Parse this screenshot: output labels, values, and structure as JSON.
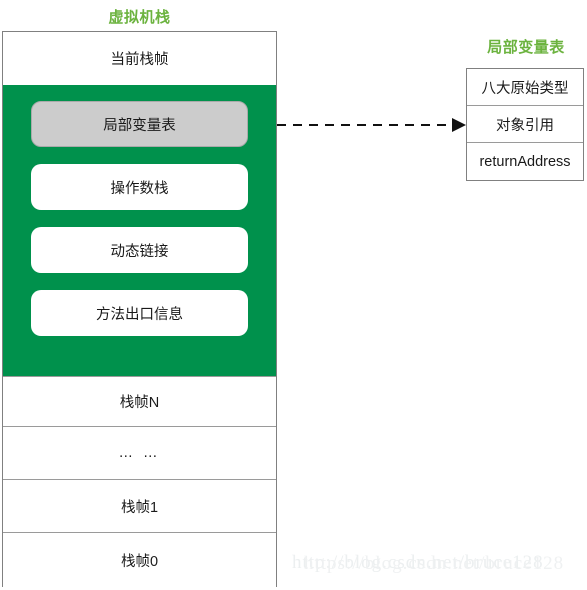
{
  "diagram": {
    "vm_stack": {
      "title": "虚拟机栈",
      "current_frame_label": "当前栈帧",
      "current_frame_items": [
        {
          "label": "局部变量表",
          "highlighted": true
        },
        {
          "label": "操作数栈",
          "highlighted": false
        },
        {
          "label": "动态链接",
          "highlighted": false
        },
        {
          "label": "方法出口信息",
          "highlighted": false
        }
      ],
      "frames": [
        {
          "label": "栈帧N"
        },
        {
          "label": "… …"
        },
        {
          "label": "栈帧1"
        },
        {
          "label": "栈帧0"
        }
      ]
    },
    "local_variable_table": {
      "title": "局部变量表",
      "rows": [
        {
          "label": "八大原始类型"
        },
        {
          "label": "对象引用"
        },
        {
          "label": "returnAddress"
        }
      ]
    },
    "connector": {
      "style": "dashed-arrow",
      "from": "局部变量表",
      "to": "局部变量表"
    }
  },
  "watermark": {
    "text": "http://blog.csdn.net/bruce128",
    "text_overlay": "https://blog.csdn.net/bruce128"
  },
  "colors": {
    "title_green": "#6cb33f",
    "panel_green": "#00914c",
    "highlight_gray": "#cccccc",
    "border_gray": "#808080",
    "text": "#1a1a1a",
    "watermark": "#eceff0"
  }
}
